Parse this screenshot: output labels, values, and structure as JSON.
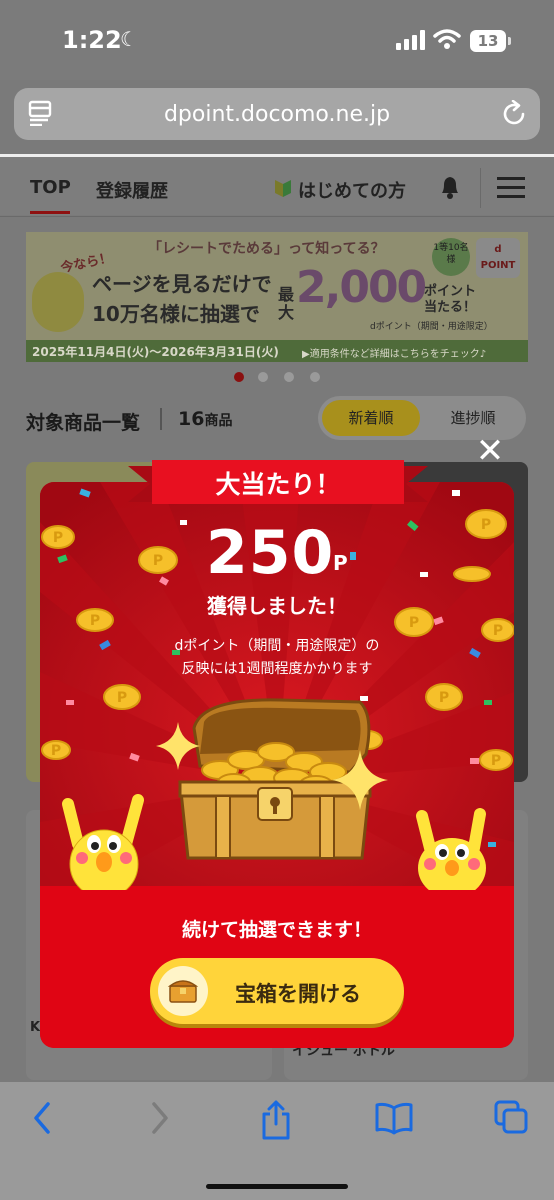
{
  "status_bar": {
    "time": "1:22",
    "battery": "13"
  },
  "browser": {
    "url": "dpoint.docomo.ne.jp"
  },
  "nav": {
    "tabs": [
      "TOP",
      "登録履歴",
      "はじめての方"
    ]
  },
  "banner": {
    "badge": "今なら！",
    "headline": "「レシートでためる」って知ってる？",
    "line1": "ページを見るだけで",
    "line2": "10万名様に抽選で",
    "max_label": "最大",
    "amount": "2,000",
    "amount_unit": "ポイント当たる！",
    "dpoint_note": "dポイント（期間・用途限定）",
    "winners_badge": "1等10名様",
    "dpoint_logo": "d POINT",
    "period": "2025年11月4日(火)〜2026年3月31日(火)",
    "details_link": "▶適用条件など詳細はこちらをチェック♪"
  },
  "list": {
    "title": "対象商品一覧",
    "count": "16",
    "count_unit": "商品",
    "sort_new": "新着順",
    "sort_progress": "進捗順"
  },
  "behind_fragments": {
    "card_text": "イシュー ボトル",
    "edge_char": "K"
  },
  "modal": {
    "ribbon": "大当たり！",
    "points": "250",
    "points_unit": "P",
    "obtained": "獲得しました！",
    "note_line1": "dポイント（期間・用途限定）の",
    "note_line2": "反映には1週間程度かかります",
    "continue": "続けて抽選できます！",
    "open_button": "宝箱を開ける",
    "coin_mark": "P"
  },
  "toolbar": {
    "icons": [
      "back-icon",
      "forward-icon",
      "share-icon",
      "bookmarks-icon",
      "tabs-icon"
    ]
  }
}
